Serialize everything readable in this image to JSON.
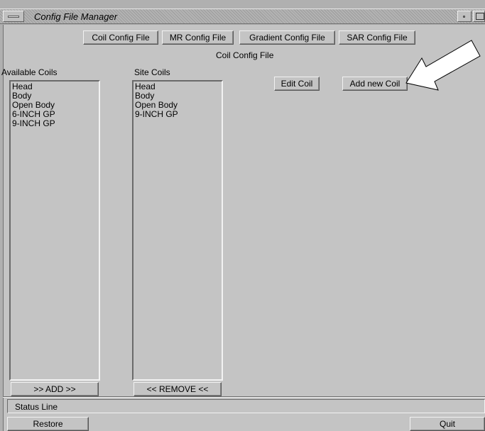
{
  "window": {
    "title": "Config File Manager"
  },
  "tabs": [
    {
      "label": "Coil Config File"
    },
    {
      "label": "MR Config File"
    },
    {
      "label": "Gradient Config File"
    },
    {
      "label": "SAR Config File"
    }
  ],
  "section_title": "Coil Config File",
  "available_coils": {
    "header": "Available Coils",
    "items": [
      "Head",
      "Body",
      "Open Body",
      "6-INCH GP",
      "9-INCH GP"
    ],
    "add_label": ">> ADD >>"
  },
  "site_coils": {
    "header": "Site Coils",
    "items": [
      "Head",
      "Body",
      "Open Body",
      "9-INCH GP"
    ],
    "remove_label": "<< REMOVE <<"
  },
  "actions": {
    "edit_coil": "Edit Coil",
    "add_new_coil": "Add new Coil"
  },
  "status": {
    "text": "Status Line"
  },
  "footer": {
    "restore": "Restore",
    "quit": "Quit"
  },
  "icons": {
    "window_menu": "window-menu-icon",
    "minimize": "minimize-icon",
    "maximize": "maximize-icon",
    "pointer_arrow": "arrow-pointer-icon"
  }
}
